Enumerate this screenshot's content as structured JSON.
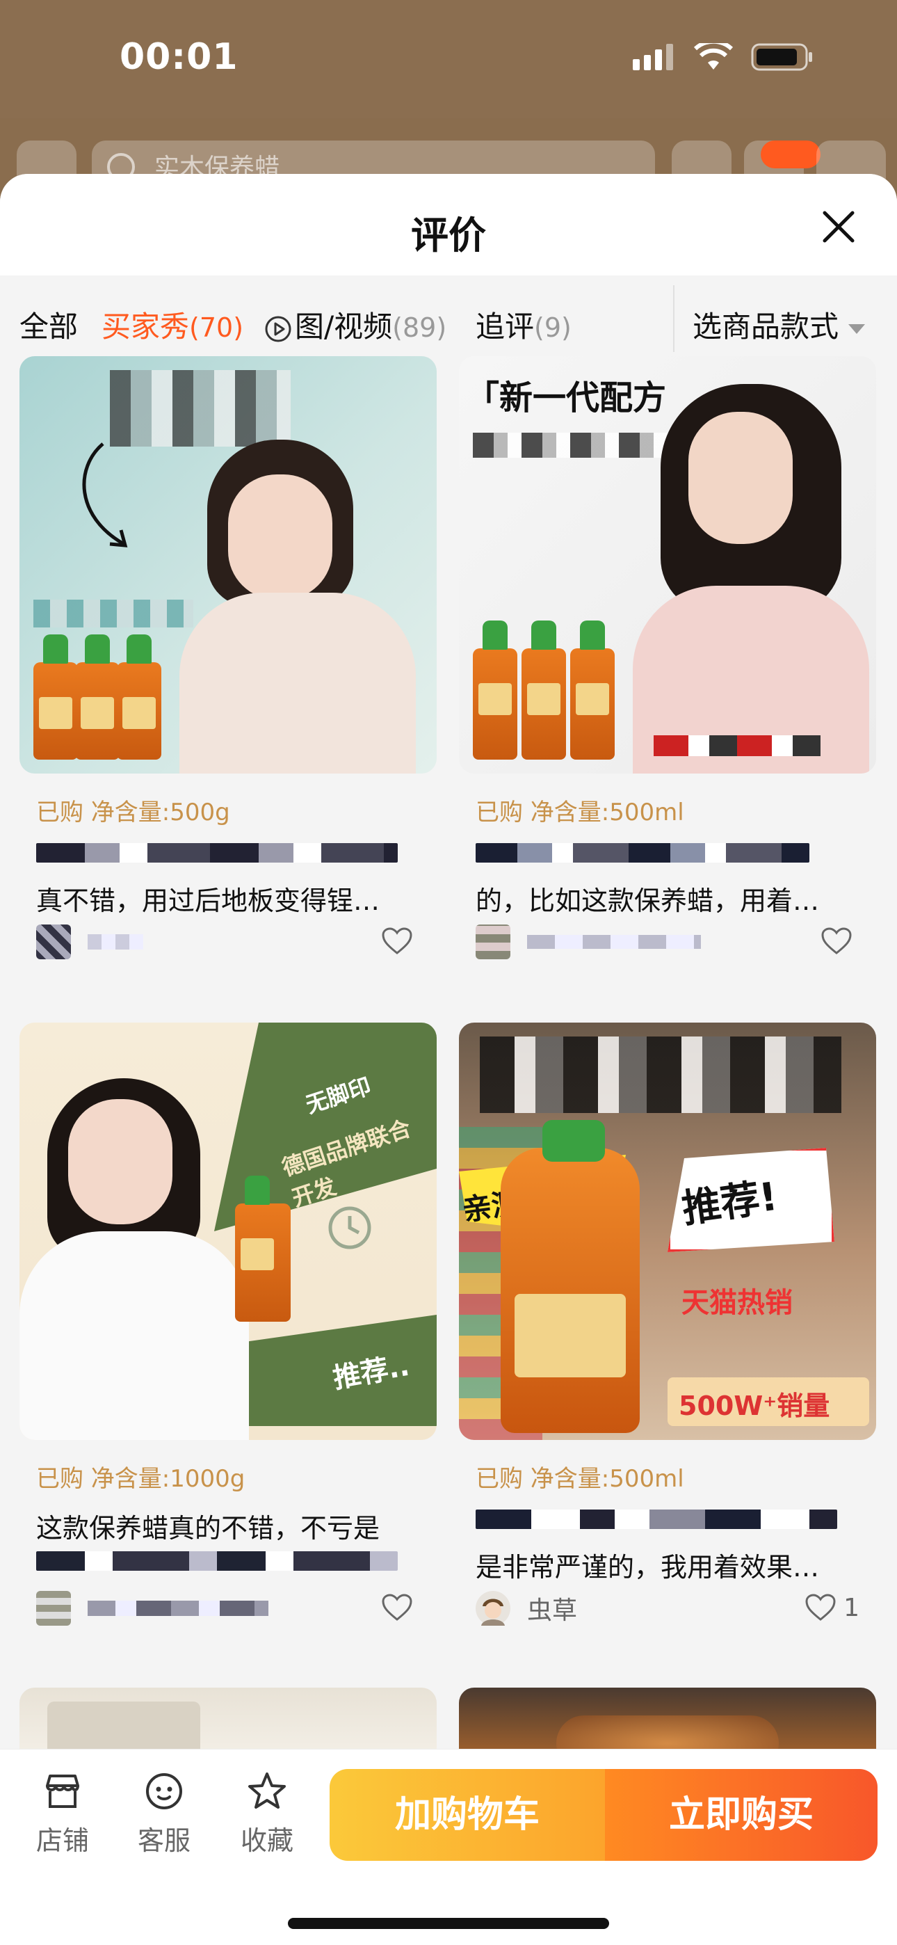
{
  "status_bar": {
    "time": "00:01"
  },
  "search": {
    "placeholder": "实木保养蜡"
  },
  "sheet": {
    "title": "评价"
  },
  "filters": [
    {
      "label": "全部",
      "count": ""
    },
    {
      "label": "买家秀",
      "count": "(70)"
    },
    {
      "label": "图/视频",
      "count": "(89)"
    },
    {
      "label": "追评",
      "count": "(9)"
    }
  ],
  "variant_select": {
    "label": "选商品款式"
  },
  "reviews": [
    {
      "meta": "已购  净含量:500g",
      "text": "真不错，用过后地板变得锃…",
      "username": "",
      "likes": "",
      "ad_text": ""
    },
    {
      "meta": "已购  净含量:500ml",
      "text": "的，比如这款保养蜡，用着…",
      "username": "",
      "likes": "",
      "ad_text": "「新一代配方"
    },
    {
      "meta": "已购  净含量:1000g",
      "text": "这款保养蜡真的不错，不亏是",
      "username": "",
      "likes": "",
      "ad_text": "德国品牌联合开发"
    },
    {
      "meta": "已购  净含量:500ml",
      "text": "是非常严谨的，我用着效果…",
      "username": "虫草",
      "likes": "1",
      "ad_text": "亲测不踩雷"
    }
  ],
  "ad_extras": {
    "card3_b": "无脚印",
    "card3_c": "推荐..",
    "card4_b": "推荐!",
    "card4_c": "天猫热销",
    "card4_d": "500W⁺销量"
  },
  "bottom_bar": {
    "store": "店铺",
    "service": "客服",
    "favorite": "收藏",
    "add_to_cart": "加购物车",
    "buy_now": "立即购买"
  },
  "colors": {
    "accent": "#ff5a1f",
    "meta_gold": "#c8924a",
    "cart_gradient_start": "#fbc93a",
    "buy_gradient_end": "#f8572a"
  }
}
